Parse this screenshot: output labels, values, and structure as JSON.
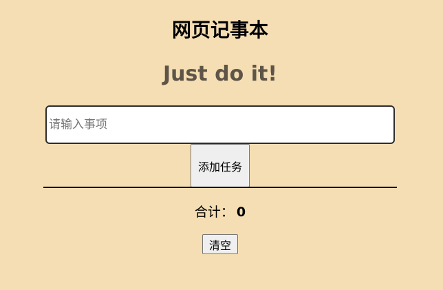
{
  "header": {
    "title": "网页记事本",
    "slogan": "Just do it!"
  },
  "input": {
    "value": "",
    "placeholder": "请输入事项"
  },
  "add_button": {
    "label": "添加任务"
  },
  "summary": {
    "label": "合计：",
    "count": "0"
  },
  "clear_button": {
    "label": "清空"
  },
  "colors": {
    "background": "#f5deb3",
    "slogan": "#5e5548",
    "button_bg": "#efefef"
  }
}
